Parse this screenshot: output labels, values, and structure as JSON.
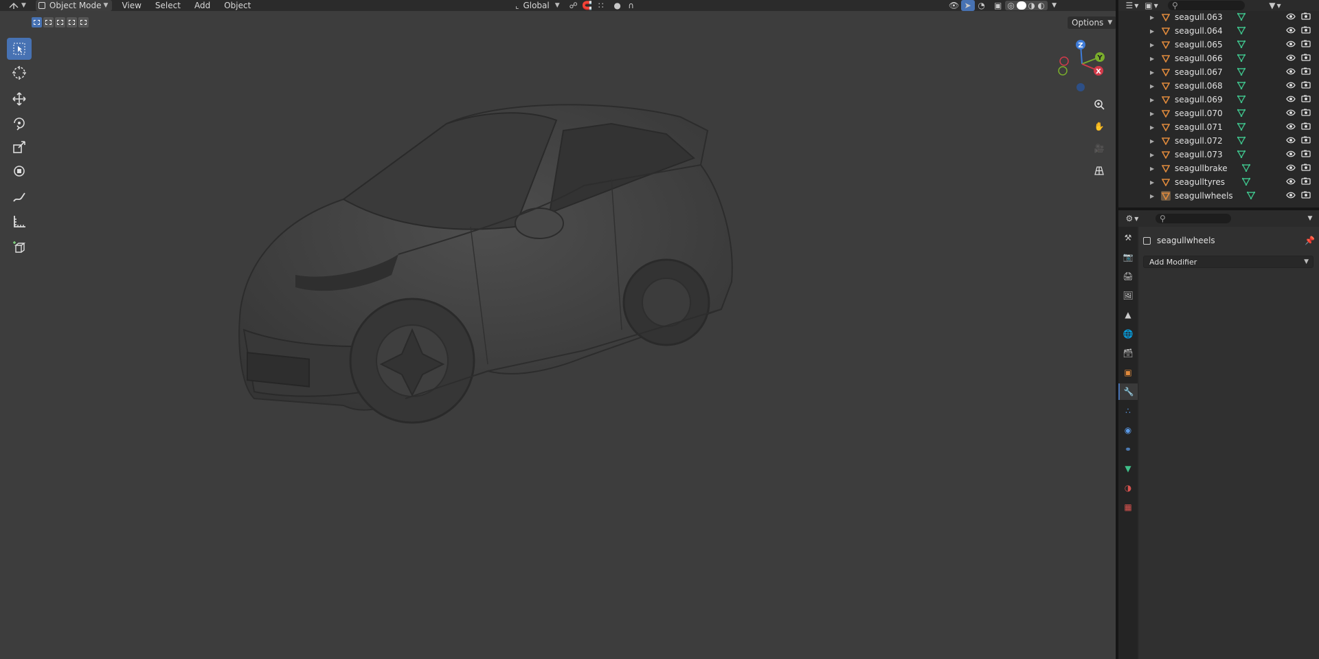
{
  "header": {
    "mode_label": "Object Mode",
    "menus": [
      "View",
      "Select",
      "Add",
      "Object"
    ],
    "transform_orientation": "Global",
    "options_label": "Options"
  },
  "gizmo": {
    "z_label": "Z",
    "y_label": "Y",
    "x_label": "X"
  },
  "outliner": {
    "rows": [
      {
        "name": "seagull.063"
      },
      {
        "name": "seagull.064"
      },
      {
        "name": "seagull.065"
      },
      {
        "name": "seagull.066"
      },
      {
        "name": "seagull.067"
      },
      {
        "name": "seagull.068"
      },
      {
        "name": "seagull.069"
      },
      {
        "name": "seagull.070"
      },
      {
        "name": "seagull.071"
      },
      {
        "name": "seagull.072"
      },
      {
        "name": "seagull.073"
      },
      {
        "name": "seagullbrake"
      },
      {
        "name": "seagulltyres"
      },
      {
        "name": "seagullwheels"
      }
    ]
  },
  "properties": {
    "object_name": "seagullwheels",
    "add_modifier_label": "Add Modifier"
  },
  "colors": {
    "accent": "#4772b3",
    "mesh_icon": "#3fc08a",
    "object_icon": "#e08a3c",
    "axis_x": "#d33a4a",
    "axis_y": "#7aae2c",
    "axis_z": "#3f7cd8"
  }
}
